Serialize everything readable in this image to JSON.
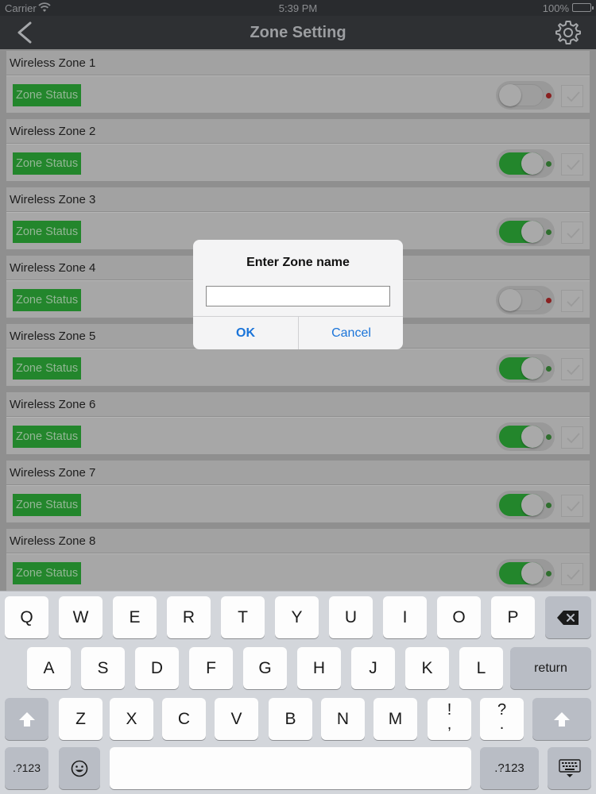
{
  "status_bar": {
    "carrier": "Carrier",
    "time": "5:39 PM",
    "battery": "100%"
  },
  "nav": {
    "title": "Zone Setting",
    "back_icon": "chevron-left-icon",
    "settings_icon": "gear-icon"
  },
  "zones": [
    {
      "name": "Wireless Zone 1",
      "status_label": "Zone Status",
      "enabled": false
    },
    {
      "name": "Wireless Zone 2",
      "status_label": "Zone Status",
      "enabled": true
    },
    {
      "name": "Wireless Zone 3",
      "status_label": "Zone Status",
      "enabled": true
    },
    {
      "name": "Wireless Zone 4",
      "status_label": "Zone Status",
      "enabled": false
    },
    {
      "name": "Wireless Zone 5",
      "status_label": "Zone Status",
      "enabled": true
    },
    {
      "name": "Wireless Zone 6",
      "status_label": "Zone Status",
      "enabled": true
    },
    {
      "name": "Wireless Zone 7",
      "status_label": "Zone Status",
      "enabled": true
    },
    {
      "name": "Wireless Zone 8",
      "status_label": "Zone Status",
      "enabled": true
    }
  ],
  "dialog": {
    "title": "Enter Zone name",
    "input_value": "",
    "ok_label": "OK",
    "cancel_label": "Cancel"
  },
  "keyboard": {
    "row1": [
      "Q",
      "W",
      "E",
      "R",
      "T",
      "Y",
      "U",
      "I",
      "O",
      "P"
    ],
    "row2": [
      "A",
      "S",
      "D",
      "F",
      "G",
      "H",
      "J",
      "K",
      "L"
    ],
    "row3": [
      "Z",
      "X",
      "C",
      "V",
      "B",
      "N",
      "M"
    ],
    "punct1": {
      "top": "!",
      "bottom": ","
    },
    "punct2": {
      "top": "?",
      "bottom": "."
    },
    "return_label": "return",
    "numbers_label": ".?123",
    "icons": {
      "delete": "backspace-icon",
      "shift": "shift-icon",
      "emoji": "emoji-icon",
      "dismiss": "keyboard-dismiss-icon"
    }
  },
  "colors": {
    "accent": "#1a74d9",
    "zone_green": "#23862c",
    "nav_bg": "#2e3033"
  }
}
